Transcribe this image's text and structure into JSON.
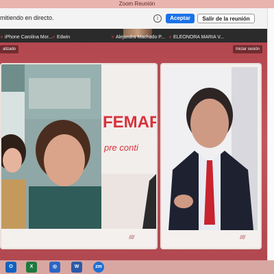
{
  "window": {
    "title": "Zoom Reunión"
  },
  "notice": {
    "text": "mitiendo en directo.",
    "accept_label": "Aceptar",
    "leave_label": "Salir de la reunión"
  },
  "participants_bar": [
    {
      "name": "iPhone Carolina Mor..."
    },
    {
      "name": "Edwin"
    },
    {
      "name": "Alejandra Machado P..."
    },
    {
      "name": "ELEONORA MARIA V..."
    }
  ],
  "stage": {
    "left_chip": "alizado",
    "right_chip": "Iniciar sesión"
  },
  "video_tiles": [
    {
      "label": "",
      "backdrop_text": "FEMAP",
      "backdrop_subtext": "pre conti"
    },
    {
      "label": ""
    }
  ],
  "taskbar": {
    "apps": [
      {
        "label": "O",
        "icon": "outlook-icon",
        "color": "#0f62c1"
      },
      {
        "label": "X",
        "icon": "excel-icon",
        "color": "#1d7a3e"
      },
      {
        "label": "◎",
        "icon": "browser-icon",
        "color": "#2b66c4"
      },
      {
        "label": "W",
        "icon": "word-icon",
        "color": "#2a5aa8"
      },
      {
        "label": "zm",
        "icon": "zoom-icon",
        "color": "#1f6fd6"
      }
    ]
  },
  "colors": {
    "accent": "#1a73e8",
    "stage_bg": "#b3474f",
    "mic_off": "#e23b3b"
  }
}
